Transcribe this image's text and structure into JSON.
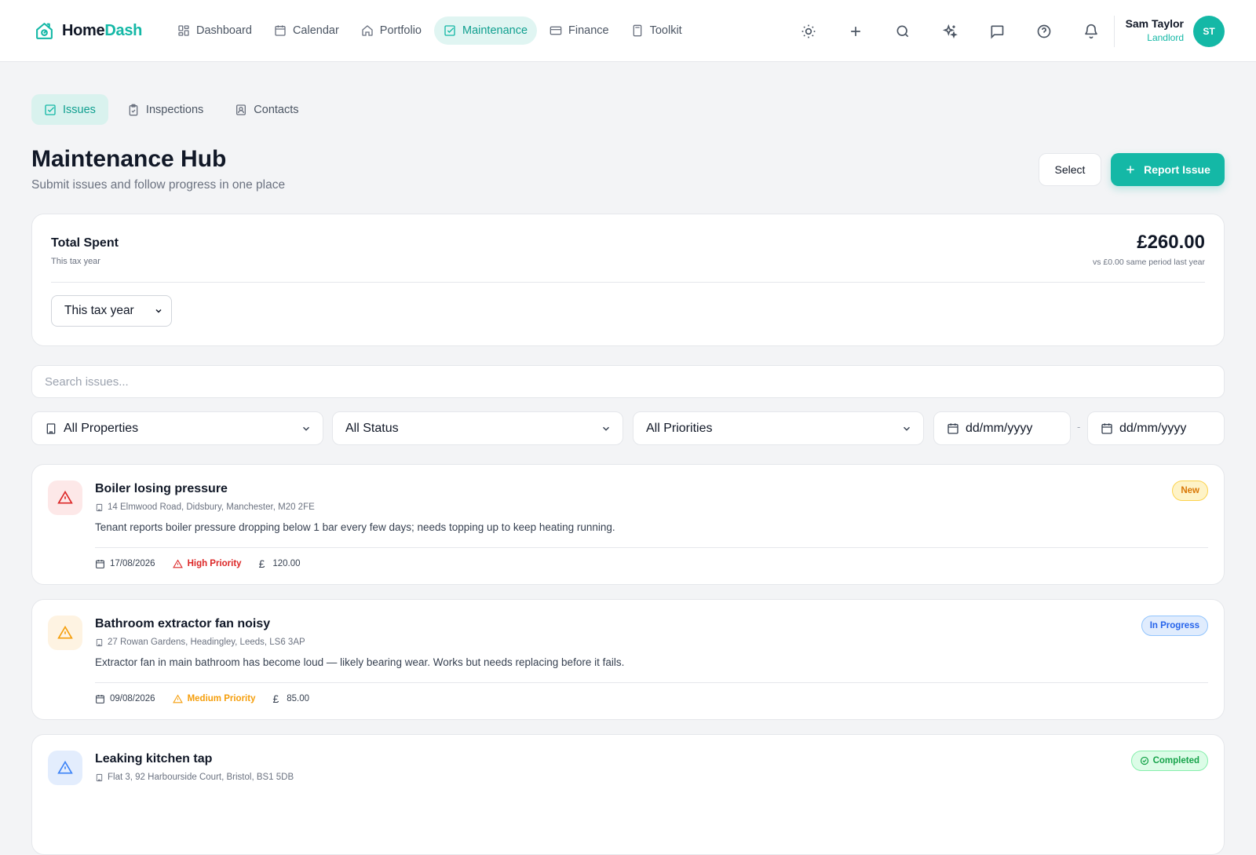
{
  "app": {
    "brand_part1": "Home",
    "brand_part2": "Dash",
    "accent": "#14b8a6"
  },
  "nav": {
    "items": [
      {
        "label": "Dashboard",
        "icon": "grid-icon"
      },
      {
        "label": "Calendar",
        "icon": "calendar-icon"
      },
      {
        "label": "Portfolio",
        "icon": "house-icon"
      },
      {
        "label": "Maintenance",
        "icon": "checkbox-icon",
        "active": true
      },
      {
        "label": "Finance",
        "icon": "card-icon"
      },
      {
        "label": "Toolkit",
        "icon": "calculator-icon"
      }
    ]
  },
  "toolbar_icons": [
    "sun-icon",
    "plus-icon",
    "search-icon",
    "sparkles-icon",
    "chat-icon",
    "help-icon",
    "bell-icon"
  ],
  "user": {
    "name": "Sam Taylor",
    "role": "Landlord",
    "initials": "ST"
  },
  "subtabs": [
    {
      "label": "Issues",
      "active": true
    },
    {
      "label": "Inspections"
    },
    {
      "label": "Contacts"
    }
  ],
  "header": {
    "title": "Maintenance Hub",
    "subtitle": "Submit issues and follow progress in one place",
    "select_label": "Select",
    "report_label": "Report Issue"
  },
  "spent": {
    "title": "Total Spent",
    "subtitle": "This tax year",
    "amount": "£260.00",
    "compare": "vs £0.00 same period last year",
    "period": "This tax year"
  },
  "search": {
    "placeholder": "Search issues..."
  },
  "filters": {
    "properties": "All Properties",
    "status": "All Status",
    "priorities": "All Priorities",
    "date_from": "dd/mm/yyyy",
    "date_separator": "-",
    "date_to": "dd/mm/yyyy"
  },
  "issues": [
    {
      "title": "Boiler losing pressure",
      "address": "14 Elmwood Road, Didsbury, Manchester, M20 2FE",
      "description": "Tenant reports boiler pressure dropping below 1 bar every few days; needs topping up to keep heating running.",
      "date": "17/08/2026",
      "priority": "High Priority",
      "currency": "£",
      "cost": "120.00",
      "status": "New",
      "priority_color": "#dc2626",
      "status_color": "#d97706"
    },
    {
      "title": "Bathroom extractor fan noisy",
      "address": "27 Rowan Gardens, Headingley, Leeds, LS6 3AP",
      "description": "Extractor fan in main bathroom has become loud — likely bearing wear. Works but needs replacing before it fails.",
      "date": "09/08/2026",
      "priority": "Medium Priority",
      "currency": "£",
      "cost": "85.00",
      "status": "In Progress",
      "priority_color": "#f59e0b",
      "status_color": "#2563eb"
    },
    {
      "title": "Leaking kitchen tap",
      "address": "Flat 3, 92 Harbourside Court, Bristol, BS1 5DB",
      "status": "Completed",
      "priority_color": "#3b82f6",
      "status_color": "#16a34a"
    }
  ]
}
